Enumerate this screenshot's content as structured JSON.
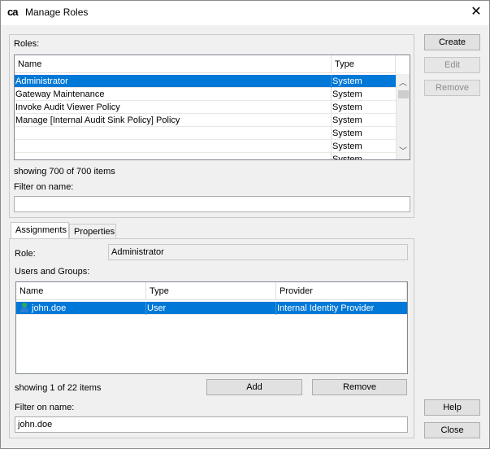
{
  "window": {
    "app_icon": "ca",
    "title": "Manage Roles",
    "close_glyph": "✕"
  },
  "roles": {
    "group_label": "Roles:",
    "columns": [
      "Name",
      "Type"
    ],
    "rows": [
      {
        "name": "Administrator",
        "type": "System",
        "selected": true
      },
      {
        "name": "Gateway Maintenance",
        "type": "System"
      },
      {
        "name": "Invoke Audit Viewer Policy",
        "type": "System"
      },
      {
        "name": "Manage [Internal Audit Sink Policy] Policy",
        "type": "System"
      },
      {
        "name": "",
        "type": "System"
      },
      {
        "name": "",
        "type": "System"
      },
      {
        "name": "",
        "type": "System"
      }
    ],
    "count_text": "showing 700 of 700 items",
    "filter_label": "Filter on name:",
    "filter_value": ""
  },
  "side_buttons": {
    "create": "Create",
    "edit": "Edit",
    "remove": "Remove",
    "help": "Help",
    "close": "Close"
  },
  "tabs": {
    "assignments": "Assignments",
    "properties": "Properties"
  },
  "assignments": {
    "role_label": "Role:",
    "role_value": "Administrator",
    "users_groups_label": "Users and Groups:",
    "columns": [
      "Name",
      "Type",
      "Provider"
    ],
    "rows": [
      {
        "name": "john.doe",
        "type": "User",
        "provider": "Internal Identity Provider",
        "icon": "user-icon",
        "selected": true
      }
    ],
    "count_text": "showing 1 of 22 items",
    "add_label": "Add",
    "remove_label": "Remove",
    "filter_label": "Filter on name:",
    "filter_value": "john.doe"
  },
  "colors": {
    "selection": "#0078d7",
    "window_bg": "#f0f0f0"
  }
}
